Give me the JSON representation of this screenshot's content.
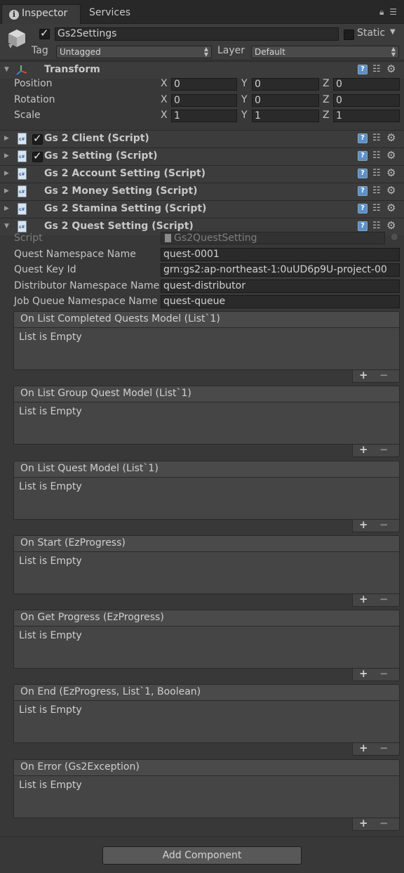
{
  "tabs": [
    {
      "label": "Inspector"
    },
    {
      "label": "Services"
    }
  ],
  "header": {
    "object_name": "Gs2Settings",
    "active": true,
    "static_label": "Static",
    "static": false,
    "tag_label": "Tag",
    "tag_value": "Untagged",
    "layer_label": "Layer",
    "layer_value": "Default"
  },
  "transform": {
    "title": "Transform",
    "rows": [
      {
        "label": "Position",
        "x": "0",
        "y": "0",
        "z": "0"
      },
      {
        "label": "Rotation",
        "x": "0",
        "y": "0",
        "z": "0"
      },
      {
        "label": "Scale",
        "x": "1",
        "y": "1",
        "z": "1"
      }
    ],
    "axis": {
      "x": "X",
      "y": "Y",
      "z": "Z"
    }
  },
  "components": [
    {
      "title": "Gs 2 Client (Script)",
      "enabled": true
    },
    {
      "title": "Gs 2 Setting (Script)",
      "enabled": true
    },
    {
      "title": "Gs 2 Account Setting (Script)"
    },
    {
      "title": "Gs 2 Money Setting (Script)"
    },
    {
      "title": "Gs 2 Stamina Setting (Script)"
    },
    {
      "title": "Gs 2 Quest Setting (Script)"
    }
  ],
  "quest": {
    "script_label": "Script",
    "script_value": "Gs2QuestSetting",
    "fields": [
      {
        "label": "Quest Namespace Name",
        "value": "quest-0001"
      },
      {
        "label": "Quest Key Id",
        "value": "grn:gs2:ap-northeast-1:0uUD6p9U-project-00"
      },
      {
        "label": "Distributor Namespace Name",
        "value": "quest-distributor"
      },
      {
        "label": "Job Queue Namespace Name",
        "value": "quest-queue"
      }
    ],
    "events": [
      {
        "title": "On List Completed Quests Model (List`1)",
        "empty": "List is Empty"
      },
      {
        "title": "On List Group Quest Model (List`1)",
        "empty": "List is Empty"
      },
      {
        "title": "On List Quest Model (List`1)",
        "empty": "List is Empty"
      },
      {
        "title": "On Start (EzProgress)",
        "empty": "List is Empty"
      },
      {
        "title": "On Get Progress (EzProgress)",
        "empty": "List is Empty"
      },
      {
        "title": "On End (EzProgress, List`1, Boolean)",
        "empty": "List is Empty"
      },
      {
        "title": "On Error (Gs2Exception)",
        "empty": "List is Empty"
      }
    ]
  },
  "add_component_label": "Add Component"
}
